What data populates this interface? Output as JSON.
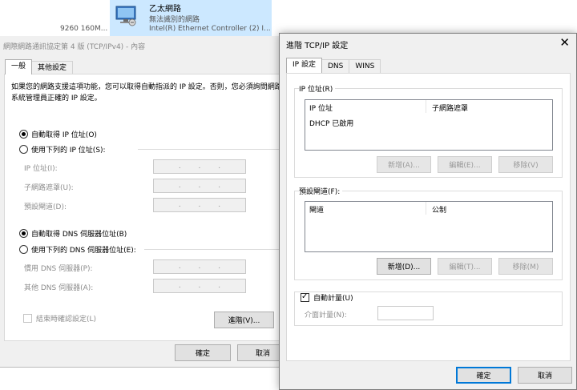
{
  "network_window": {
    "adapter_partial_text": "9260 160M...",
    "adapter_name": "乙太網路",
    "adapter_status": "無法識別的網路",
    "adapter_device": "Intel(R) Ethernet Controller (2) I..."
  },
  "ipv4_dialog": {
    "title": "網際網路通訊協定第 4 版 (TCP/IPv4) - 內容",
    "tabs": [
      "一般",
      "其他設定"
    ],
    "description": "如果您的網路支援這項功能，您可以取得自動指派的 IP 設定。否則，您必須詢問網路系統管理員正確的 IP 設定。",
    "auto_ip_label": "自動取得 IP 位址(O)",
    "manual_ip_label": "使用下列的 IP 位址(S):",
    "ip_address_label": "IP 位址(I):",
    "subnet_label": "子網路遮罩(U):",
    "gateway_label": "預設閘道(D):",
    "auto_dns_label": "自動取得 DNS 伺服器位址(B)",
    "manual_dns_label": "使用下列的 DNS 伺服器位址(E):",
    "preferred_dns_label": "慣用 DNS 伺服器(P):",
    "alternate_dns_label": "其他 DNS 伺服器(A):",
    "validate_label": "結束時確認設定(L)",
    "advanced_button": "進階(V)...",
    "ok_button": "確定",
    "cancel_button": "取消",
    "ip_address_dots": [
      ".",
      ".",
      "."
    ],
    "selected_ip_mode": "auto",
    "selected_dns_mode": "auto",
    "validate_checked": false
  },
  "advanced_dialog": {
    "title": "進階 TCP/IP 設定",
    "close_symbol": "✕",
    "tabs": [
      "IP 設定",
      "DNS",
      "WINS"
    ],
    "ip_group_label": "IP 位址(R)",
    "ip_columns": [
      "IP 位址",
      "子網路遮罩"
    ],
    "ip_rows": [
      "DHCP 已啟用"
    ],
    "ip_add_button": "新增(A)...",
    "ip_edit_button": "編輯(E)...",
    "ip_remove_button": "移除(V)",
    "gateway_group_label": "預設閘道(F):",
    "gateway_columns": [
      "閘道",
      "公制"
    ],
    "gw_add_button": "新增(D)...",
    "gw_edit_button": "編輯(T)...",
    "gw_remove_button": "移除(M)",
    "auto_metric_label": "自動計量(U)",
    "auto_metric_checked": true,
    "interface_metric_label": "介面計量(N):",
    "interface_metric_value": "",
    "ok_button": "確定",
    "cancel_button": "取消"
  },
  "colors": {
    "dialog_bg": "#f0f0f0",
    "selection_bg": "#cce8ff",
    "focus_border": "#0078d7",
    "disabled_text": "#8d8d8d"
  }
}
